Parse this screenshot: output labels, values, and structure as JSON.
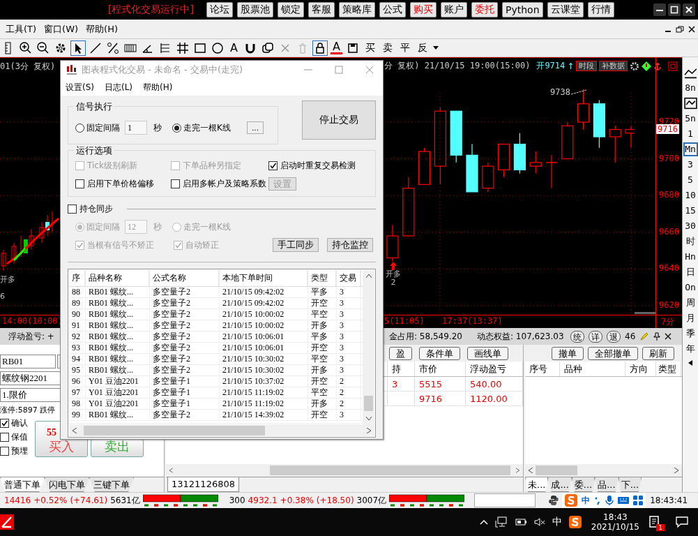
{
  "title_bar": {
    "status": "[程式化交易运行中]",
    "buttons": [
      {
        "label": "论坛",
        "highlight": false
      },
      {
        "label": "股票池",
        "highlight": false
      },
      {
        "label": "锁定",
        "highlight": false
      },
      {
        "label": "客服",
        "highlight": false
      },
      {
        "label": "策略库",
        "highlight": false
      },
      {
        "label": "公式",
        "highlight": false
      },
      {
        "label": "购买",
        "highlight": true
      },
      {
        "label": "账户",
        "highlight": false
      },
      {
        "label": "委托",
        "highlight": true
      },
      {
        "label": "Python",
        "highlight": false
      },
      {
        "label": "云课堂",
        "highlight": false
      },
      {
        "label": "行情",
        "highlight": false
      }
    ]
  },
  "menu": [
    "工具(T)",
    "窗口(W)",
    "帮助(H)"
  ],
  "toolbar": {
    "text_tool": "A",
    "font_color": "A",
    "trade_buttons": [
      "买",
      "卖",
      "平",
      "反"
    ]
  },
  "chart": {
    "left_header": "01(3分 复权)",
    "header": "分 复权) 21/10/15 19:00(15:00)",
    "open": "开9714",
    "arrow": "↑",
    "buttons": [
      "时段",
      "补数据"
    ],
    "chart_data": {
      "type": "candlestick",
      "grid": true,
      "ylim": [
        9615,
        9755
      ],
      "yticks": [
        9720,
        9700,
        9680,
        9660,
        9640,
        9620
      ],
      "ohlc": [
        [
          9646,
          9664,
          9644,
          9658
        ],
        [
          9658,
          9690,
          9658,
          9684
        ],
        [
          9686,
          9706,
          9686,
          9704
        ],
        [
          9696,
          9728,
          9686,
          9726
        ],
        [
          9726,
          9726,
          9698,
          9702
        ],
        [
          9702,
          9708,
          9682,
          9682
        ],
        [
          9684,
          9698,
          9682,
          9696
        ],
        [
          9694,
          9708,
          9690,
          9708
        ],
        [
          9708,
          9714,
          9692,
          9694
        ],
        [
          9696,
          9704,
          9692,
          9698
        ],
        [
          9698,
          9702,
          9684,
          9698
        ],
        [
          9700,
          9720,
          9700,
          9718
        ],
        [
          9720,
          9738,
          9716,
          9730
        ],
        [
          9730,
          9732,
          9706,
          9712
        ],
        [
          9712,
          9718,
          9698,
          9716
        ],
        [
          9714,
          9718,
          9706,
          9716
        ]
      ]
    },
    "last_price": "9716",
    "high_label": "9738",
    "signals": [
      {
        "label": "开多",
        "sub": "2"
      }
    ],
    "left_signals": [
      "开多",
      "6"
    ],
    "time_labels": [
      "14:00(10:00)",
      "5(11:05)",
      "17:37(13:37)"
    ],
    "period_label": "7分"
  },
  "period_bar": [
    {
      "kind": "icon",
      "selected": false
    },
    {
      "kind": "text",
      "label": "8n",
      "selected": false
    },
    {
      "kind": "icon",
      "selected": false
    },
    {
      "kind": "text",
      "label": "5n",
      "selected": false
    },
    {
      "kind": "text",
      "label": "1",
      "selected": false
    },
    {
      "kind": "text",
      "label": "Mn",
      "selected": true
    },
    {
      "kind": "text",
      "label": "3",
      "selected": false
    },
    {
      "kind": "text",
      "label": "5",
      "selected": false
    },
    {
      "kind": "text",
      "label": "10",
      "selected": false
    },
    {
      "kind": "text",
      "label": "15",
      "selected": false
    },
    {
      "kind": "text",
      "label": "30",
      "selected": false
    },
    {
      "kind": "text",
      "label": "时",
      "selected": false
    },
    {
      "kind": "text",
      "label": "Hn",
      "selected": false
    },
    {
      "kind": "text",
      "label": "日",
      "selected": false
    },
    {
      "kind": "text",
      "label": "On",
      "selected": false
    },
    {
      "kind": "text",
      "label": "周",
      "selected": false
    },
    {
      "kind": "text",
      "label": "月",
      "selected": false
    },
    {
      "kind": "text",
      "label": "季",
      "selected": false
    },
    {
      "kind": "text",
      "label": "年",
      "selected": false
    }
  ],
  "dialog": {
    "title": "图表程式化交易 - 未命名 - 交易中(走完)",
    "menu": [
      "设置(S)",
      "日志(L)",
      "帮助(H)"
    ],
    "signal_group": {
      "title": "信号执行",
      "interval_label": "固定间隔",
      "interval_selected": false,
      "interval_value": "1",
      "unit": "秒",
      "bar_label": "走完一根K线",
      "bar_selected": true,
      "more": "..."
    },
    "stop_button": "停止交易",
    "options_group": {
      "title": "运行选项",
      "options": [
        {
          "label": "Tick级别刷新",
          "checked": false,
          "disabled": true
        },
        {
          "label": "下单品种另指定",
          "checked": false,
          "disabled": true
        },
        {
          "label": "启动时重复交易检测",
          "checked": true,
          "disabled": false
        },
        {
          "label": "启用下单价格偏移",
          "checked": false,
          "disabled": false
        },
        {
          "label": "启用多帐户及策略系数",
          "checked": false,
          "disabled": false
        }
      ],
      "settings_button": "设置"
    },
    "sync": {
      "label": "持仓同步",
      "checked": false,
      "interval_label": "固定间隔",
      "interval_selected": true,
      "interval_value": "12",
      "unit": "秒",
      "bar_label": "走完一根K线",
      "bar_selected": false,
      "disabled": true,
      "options": [
        {
          "label": "当根有信号不矫正",
          "checked": true
        },
        {
          "label": "自动矫正",
          "checked": true
        }
      ],
      "buttons": [
        "手工同步",
        "持仓监控"
      ]
    },
    "table": {
      "columns": [
        "序",
        "品种名称",
        "公式名称",
        "本地下单时间",
        "类型",
        "交易"
      ],
      "rows": [
        [
          "88",
          "RB01 螺纹...",
          "多空量子2",
          "21/10/15 09:42:02",
          "平多",
          "3"
        ],
        [
          "89",
          "RB01 螺纹...",
          "多空量子2",
          "21/10/15 09:42:02",
          "开空",
          "3"
        ],
        [
          "90",
          "RB01 螺纹...",
          "多空量子2",
          "21/10/15 10:00:02",
          "平空",
          "3"
        ],
        [
          "91",
          "RB01 螺纹...",
          "多空量子2",
          "21/10/15 10:00:02",
          "开多",
          "3"
        ],
        [
          "92",
          "RB01 螺纹...",
          "多空量子2",
          "21/10/15 10:06:01",
          "平多",
          "3"
        ],
        [
          "93",
          "RB01 螺纹...",
          "多空量子2",
          "21/10/15 10:06:01",
          "开空",
          "3"
        ],
        [
          "94",
          "RB01 螺纹...",
          "多空量子2",
          "21/10/15 10:30:02",
          "平空",
          "3"
        ],
        [
          "95",
          "RB01 螺纹...",
          "多空量子2",
          "21/10/15 10:30:02",
          "开多",
          "3"
        ],
        [
          "96",
          "Y01 豆油2201",
          "多空量子1",
          "21/10/15 10:37:02",
          "开空",
          "2"
        ],
        [
          "97",
          "Y01 豆油2201",
          "多空量子1",
          "21/10/15 11:19:02",
          "平空",
          "2"
        ],
        [
          "98",
          "Y01 豆油2201",
          "多空量子1",
          "21/10/15 11:19:02",
          "开多",
          "2"
        ],
        [
          "99",
          "RB01 螺纹...",
          "多空量子2",
          "21/10/15 14:39:02",
          "开空",
          "3"
        ]
      ]
    }
  },
  "account_bar": {
    "float_pnl": "浮动盈亏: +",
    "margin": "金占用: 58,549.20",
    "equity": "动态权益: 107,623.03",
    "buttons": [
      "统",
      "详",
      "退"
    ],
    "extra": "46"
  },
  "order_panel": {
    "code": "RB01",
    "name": "螺纹钢2201",
    "price_type": "1.限价",
    "limits": "涨停:5897 跌停",
    "options": [
      {
        "label": "确认",
        "checked": true
      },
      {
        "label": "保值",
        "checked": false
      },
      {
        "label": "预埋",
        "checked": false
      }
    ],
    "buy_price": "55",
    "buy": "买入",
    "sell": "卖出",
    "tabs": [
      {
        "label": "普通下单",
        "selected": true
      },
      {
        "label": "闪电下单",
        "selected": false
      },
      {
        "label": "三键下单",
        "selected": false
      }
    ]
  },
  "positions": {
    "buttons": [
      "盈",
      "条件单",
      "画线单"
    ],
    "columns": [
      "持",
      "市价",
      "浮动盈亏"
    ],
    "rows": [
      [
        "3",
        "5515",
        "540.00"
      ],
      [
        "",
        "9716",
        "1120.00"
      ]
    ],
    "tab": "13121126808"
  },
  "orders": {
    "buttons": [
      "撤单",
      "全部撤单",
      "刷新"
    ],
    "columns": [
      "序号",
      "品种",
      "方向",
      "类型"
    ],
    "tabs": [
      {
        "label": "未...",
        "selected": true
      },
      {
        "label": "成...",
        "selected": false
      },
      {
        "label": "委...",
        "selected": false
      },
      {
        "label": "品...",
        "selected": false
      },
      {
        "label": "下...",
        "selected": false
      }
    ]
  },
  "status_bar": {
    "index1": {
      "value": "14416",
      "change": "+0.52%",
      "points": "(+74.61)",
      "volume": "5631亿"
    },
    "index2": {
      "name": "300",
      "value": "4932.1",
      "change": "+0.38%",
      "points": "(+18.50)",
      "volume": "3007亿"
    },
    "ime": "中",
    "clock": "18:43:41"
  },
  "taskbar": {
    "ime": "中",
    "time": "18:43",
    "date": "2021/10/15",
    "badge": "1"
  }
}
